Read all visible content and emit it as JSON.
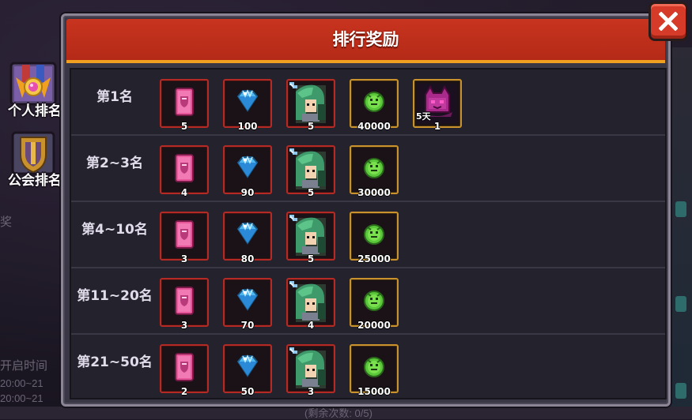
{
  "background": {
    "left_texts": [
      "奖",
      "开启时间",
      "20:00~21",
      "20:00~21"
    ],
    "bottom_text": "(剩余次数: 0/5)"
  },
  "tabs": [
    {
      "label": "个人排名",
      "icon": "personal-rank-medal-icon",
      "active": true
    },
    {
      "label": "公会排名",
      "icon": "guild-rank-shield-icon",
      "active": false
    }
  ],
  "panel": {
    "title": "排行奖励",
    "close_icon": "close-icon"
  },
  "colors": {
    "header": "#c8341f",
    "header_trim": "#f0a020",
    "red_frame": "#b52a24",
    "gold_frame": "#c9922c",
    "row_bg": "#24222c"
  },
  "rows": [
    {
      "rank": "第1名",
      "rewards": [
        {
          "type": "card",
          "icon": "pink-card-icon",
          "frame": "red",
          "count": "5"
        },
        {
          "type": "diamond",
          "icon": "diamond-icon",
          "frame": "red",
          "count": "100"
        },
        {
          "type": "hero",
          "icon": "green-hair-hero-icon",
          "frame": "red",
          "count": "5"
        },
        {
          "type": "coin",
          "icon": "green-coin-icon",
          "frame": "gold",
          "count": "40000"
        },
        {
          "type": "cat",
          "icon": "purple-cat-icon",
          "frame": "gold",
          "count": "1",
          "days": "5天"
        }
      ]
    },
    {
      "rank": "第2~3名",
      "rewards": [
        {
          "type": "card",
          "icon": "pink-card-icon",
          "frame": "red",
          "count": "4"
        },
        {
          "type": "diamond",
          "icon": "diamond-icon",
          "frame": "red",
          "count": "90"
        },
        {
          "type": "hero",
          "icon": "green-hair-hero-icon",
          "frame": "red",
          "count": "5"
        },
        {
          "type": "coin",
          "icon": "green-coin-icon",
          "frame": "gold",
          "count": "30000"
        }
      ]
    },
    {
      "rank": "第4~10名",
      "rewards": [
        {
          "type": "card",
          "icon": "pink-card-icon",
          "frame": "red",
          "count": "3"
        },
        {
          "type": "diamond",
          "icon": "diamond-icon",
          "frame": "red",
          "count": "80"
        },
        {
          "type": "hero",
          "icon": "green-hair-hero-icon",
          "frame": "red",
          "count": "5"
        },
        {
          "type": "coin",
          "icon": "green-coin-icon",
          "frame": "gold",
          "count": "25000"
        }
      ]
    },
    {
      "rank": "第11~20名",
      "rewards": [
        {
          "type": "card",
          "icon": "pink-card-icon",
          "frame": "red",
          "count": "3"
        },
        {
          "type": "diamond",
          "icon": "diamond-icon",
          "frame": "red",
          "count": "70"
        },
        {
          "type": "hero",
          "icon": "green-hair-hero-icon",
          "frame": "red",
          "count": "4"
        },
        {
          "type": "coin",
          "icon": "green-coin-icon",
          "frame": "gold",
          "count": "20000"
        }
      ]
    },
    {
      "rank": "第21~50名",
      "rewards": [
        {
          "type": "card",
          "icon": "pink-card-icon",
          "frame": "red",
          "count": "2"
        },
        {
          "type": "diamond",
          "icon": "diamond-icon",
          "frame": "red",
          "count": "50"
        },
        {
          "type": "hero",
          "icon": "green-hair-hero-icon",
          "frame": "red",
          "count": "3"
        },
        {
          "type": "coin",
          "icon": "green-coin-icon",
          "frame": "gold",
          "count": "15000"
        }
      ]
    }
  ]
}
